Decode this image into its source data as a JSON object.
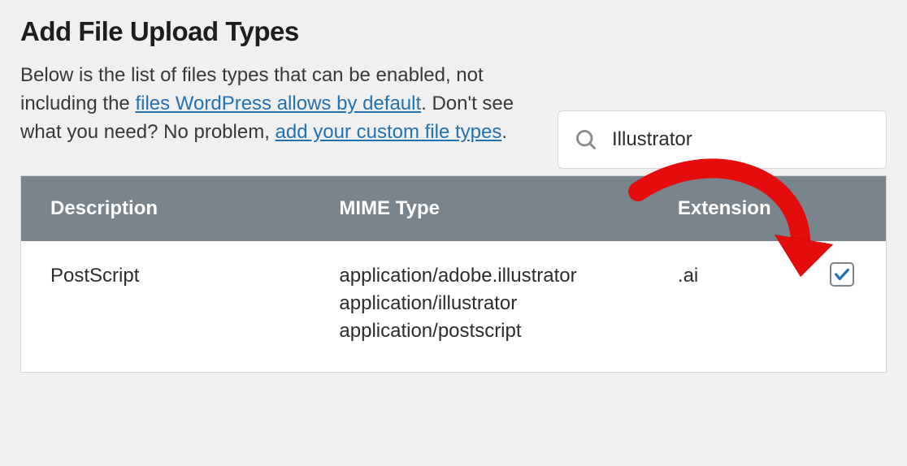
{
  "title": "Add File Upload Types",
  "intro": {
    "part1": "Below is the list of files types that can be enabled, not including the ",
    "link1": "files WordPress allows by default",
    "part2": ". Don't see what you need? No problem, ",
    "link2": "add your custom file types",
    "part3": "."
  },
  "search": {
    "value": "Illustrator"
  },
  "table": {
    "headers": {
      "description": "Description",
      "mime": "MIME Type",
      "extension": "Extension"
    },
    "rows": [
      {
        "description": "PostScript",
        "mime": "application/adobe.illustrator\napplication/illustrator\napplication/postscript",
        "extension": ".ai",
        "checked": true
      }
    ]
  }
}
